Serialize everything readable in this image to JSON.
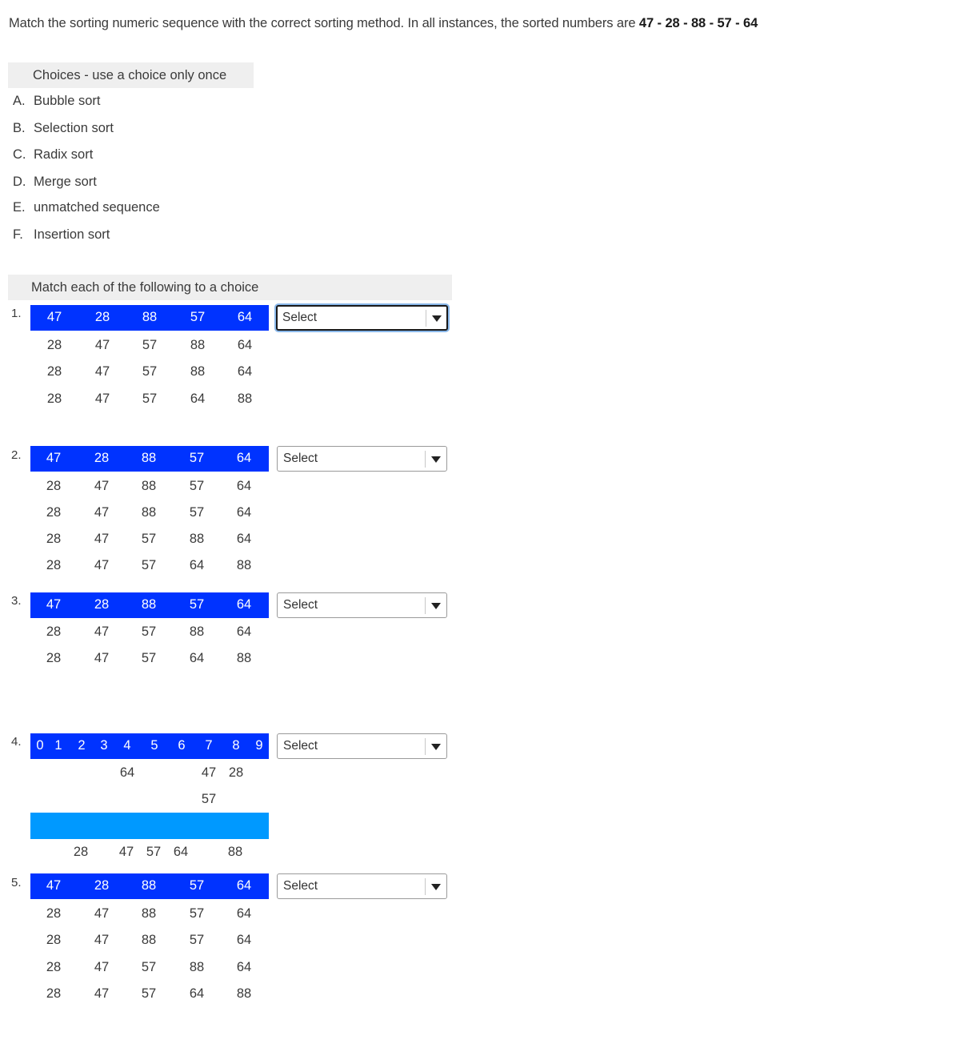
{
  "instructions": {
    "text": "Match the sorting numeric sequence with the correct sorting method. In all instances, the sorted numbers are ",
    "sequence": "47 - 28 - 88  - 57  - 64"
  },
  "choices": {
    "header": "Choices - use a choice only once",
    "items": [
      {
        "letter": "A.",
        "label": "Bubble sort"
      },
      {
        "letter": "B.",
        "label": "Selection sort"
      },
      {
        "letter": "C.",
        "label": "Radix sort"
      },
      {
        "letter": "D.",
        "label": "Merge sort"
      },
      {
        "letter": "E.",
        "label": "unmatched sequence"
      },
      {
        "letter": "F.",
        "label": "Insertion sort"
      }
    ]
  },
  "match": {
    "header": "Match each of the following to a choice",
    "select_placeholder": "Select",
    "questions": [
      {
        "number": "1.",
        "header_row": [
          "47",
          "28",
          "88",
          "57",
          "64"
        ],
        "rows": [
          [
            "28",
            "47",
            "57",
            "88",
            "64"
          ],
          [
            "28",
            "47",
            "57",
            "88",
            "64"
          ],
          [
            "28",
            "47",
            "57",
            "64",
            "88"
          ]
        ],
        "selected": "Select",
        "focused": true
      },
      {
        "number": "2.",
        "header_row": [
          "47",
          "28",
          "88",
          "57",
          "64"
        ],
        "rows": [
          [
            "28",
            "47",
            "88",
            "57",
            "64"
          ],
          [
            "28",
            "47",
            "88",
            "57",
            "64"
          ],
          [
            "28",
            "47",
            "57",
            "88",
            "64"
          ],
          [
            "28",
            "47",
            "57",
            "64",
            "88"
          ]
        ],
        "selected": "Select",
        "focused": false
      },
      {
        "number": "3.",
        "header_row": [
          "47",
          "28",
          "88",
          "57",
          "64"
        ],
        "rows": [
          [
            "28",
            "47",
            "57",
            "88",
            "64"
          ],
          [
            "28",
            "47",
            "57",
            "64",
            "88"
          ]
        ],
        "selected": "Select",
        "focused": false
      },
      {
        "number": "4.",
        "buckets": [
          "0",
          "1",
          "2",
          "3",
          "4",
          "5",
          "6",
          "7",
          "8",
          "9"
        ],
        "bucket_contents": [
          {
            "bucket": "4",
            "values": [
              "64"
            ]
          },
          {
            "bucket": "7",
            "values": [
              "47",
              "57"
            ]
          },
          {
            "bucket": "8",
            "values": [
              "28"
            ]
          }
        ],
        "result_row": [
          "28",
          "47",
          "57",
          "64",
          "88"
        ],
        "selected": "Select",
        "focused": false
      },
      {
        "number": "5.",
        "header_row": [
          "47",
          "28",
          "88",
          "57",
          "64"
        ],
        "rows": [
          [
            "28",
            "47",
            "88",
            "57",
            "64"
          ],
          [
            "28",
            "47",
            "88",
            "57",
            "64"
          ],
          [
            "28",
            "47",
            "57",
            "88",
            "64"
          ],
          [
            "28",
            "47",
            "57",
            "64",
            "88"
          ]
        ],
        "selected": "Select",
        "focused": false
      }
    ]
  },
  "colors": {
    "row_highlight": "#0033ff",
    "bucket_bar": "#0099ff",
    "header_bg": "#efefef",
    "focus_ring": "#8ab8ea"
  }
}
